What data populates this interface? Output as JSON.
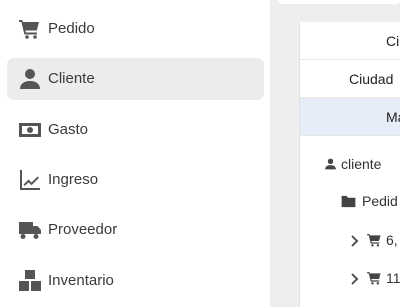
{
  "sidebar": {
    "items": [
      {
        "label": "Pedido",
        "icon": "cart-icon"
      },
      {
        "label": "Cliente",
        "icon": "user-icon",
        "active": true
      },
      {
        "label": "Gasto",
        "icon": "money-icon"
      },
      {
        "label": "Ingreso",
        "icon": "chart-line-icon"
      },
      {
        "label": "Proveedor",
        "icon": "truck-icon"
      },
      {
        "label": "Inventario",
        "icon": "boxes-icon"
      }
    ]
  },
  "main": {
    "rows": [
      "Ci",
      "Ciudad",
      "Ma"
    ],
    "tree": {
      "root": "cliente",
      "folder": "Pedid",
      "entries": [
        "6,",
        "11"
      ]
    }
  }
}
